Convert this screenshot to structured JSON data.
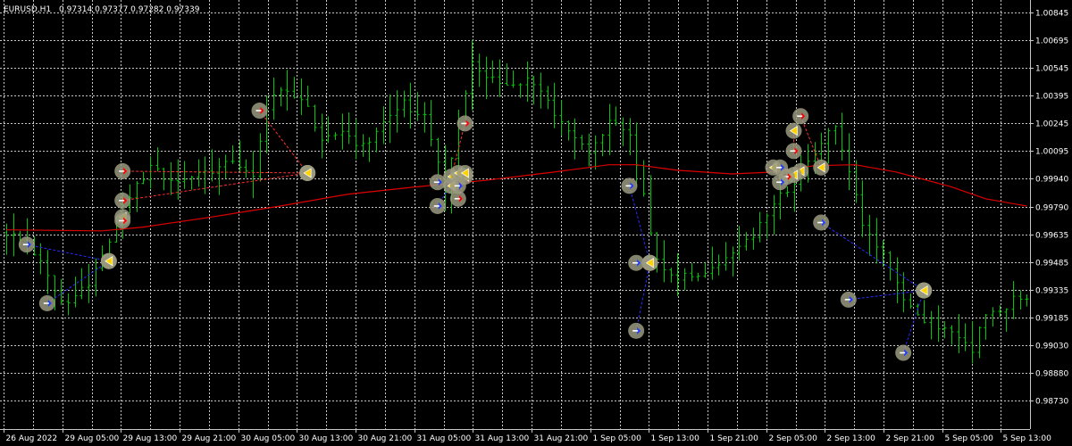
{
  "header": {
    "symbol": "EURUSD,H1",
    "ohlc": "0.97314 0.97377 0.97282 0.97339"
  },
  "colors": {
    "background": "#000000",
    "grid": "#c8c8c8",
    "bar": "#00c800",
    "moving_average": "#e00000",
    "buy_link": "#ff3030",
    "sell_link": "#2a2aff",
    "marker_ring": "#9a9a80",
    "buy_arrow": "#ff0000",
    "sell_arrow": "#1e3cff",
    "close_arrow": "#ffd200",
    "axis_text": "#ffffff"
  },
  "chart_data": {
    "type": "candlestick",
    "x_tick_labels": [
      "26 Aug 2022",
      "29 Aug 05:00",
      "29 Aug 13:00",
      "29 Aug 21:00",
      "30 Aug 05:00",
      "30 Aug 13:00",
      "30 Aug 21:00",
      "31 Aug 05:00",
      "31 Aug 13:00",
      "31 Aug 21:00",
      "1 Sep 05:00",
      "1 Sep 13:00",
      "1 Sep 21:00",
      "2 Sep 05:00",
      "2 Sep 13:00",
      "2 Sep 21:00",
      "5 Sep 05:00",
      "5 Sep 13:00"
    ],
    "y_tick_labels": [
      "1.00845",
      "1.00695",
      "1.00545",
      "1.00395",
      "1.00245",
      "1.00095",
      "0.99940",
      "0.99790",
      "0.99635",
      "0.99485",
      "0.99335",
      "0.99185",
      "0.99030",
      "0.98880",
      "0.98730"
    ],
    "ylim": [
      0.9873,
      1.00845
    ],
    "price_anchors": [
      [
        0,
        0.99645
      ],
      [
        3,
        0.996
      ],
      [
        5,
        0.9948
      ],
      [
        7,
        0.99315
      ],
      [
        9,
        0.99265
      ],
      [
        12,
        0.9938
      ],
      [
        14,
        0.99505
      ],
      [
        16,
        0.99715
      ],
      [
        18,
        0.99835
      ],
      [
        21,
        1.00015
      ],
      [
        24,
        0.99925
      ],
      [
        27,
        0.99945
      ],
      [
        30,
        0.99985
      ],
      [
        33,
        1.0002
      ],
      [
        36,
        0.9994
      ],
      [
        38,
        1.00335
      ],
      [
        40,
        1.0043
      ],
      [
        43,
        1.0039
      ],
      [
        46,
        1.0015
      ],
      [
        49,
        1.0018
      ],
      [
        52,
        1.0012
      ],
      [
        55,
        1.00235
      ],
      [
        58,
        1.0035
      ],
      [
        61,
        1.0028
      ],
      [
        64,
        0.9987
      ],
      [
        66,
        1.00245
      ],
      [
        68,
        1.00575
      ],
      [
        70,
        1.00485
      ],
      [
        73,
        1.00455
      ],
      [
        76,
        1.0048
      ],
      [
        79,
        1.0036
      ],
      [
        82,
        1.00195
      ],
      [
        85,
        1.00095
      ],
      [
        88,
        1.0025
      ],
      [
        91,
        1.0016
      ],
      [
        93,
        0.99835
      ],
      [
        95,
        0.9948
      ],
      [
        97,
        0.9942
      ],
      [
        100,
        0.99395
      ],
      [
        103,
        0.99455
      ],
      [
        106,
        0.9955
      ],
      [
        109,
        0.99625
      ],
      [
        112,
        0.99795
      ],
      [
        115,
        0.9993
      ],
      [
        117,
        1.0002
      ],
      [
        119,
        1.00145
      ],
      [
        121,
        1.00235
      ],
      [
        123,
        0.99985
      ],
      [
        125,
        0.9968
      ],
      [
        127,
        0.99555
      ],
      [
        129,
        0.99465
      ],
      [
        131,
        0.99265
      ],
      [
        133,
        0.99195
      ],
      [
        135,
        0.99155
      ],
      [
        137,
        0.99125
      ],
      [
        139,
        0.99065
      ],
      [
        141,
        0.99015
      ],
      [
        143,
        0.9919
      ],
      [
        145,
        0.992
      ],
      [
        147,
        0.9928
      ],
      [
        149,
        0.99295
      ]
    ],
    "moving_average": [
      [
        0,
        0.9966
      ],
      [
        14,
        0.99655
      ],
      [
        20,
        0.99675
      ],
      [
        30,
        0.9973
      ],
      [
        40,
        0.9979
      ],
      [
        50,
        0.99855
      ],
      [
        60,
        0.99895
      ],
      [
        70,
        0.9993
      ],
      [
        80,
        0.99975
      ],
      [
        88,
        1.00015
      ],
      [
        92,
        1.00015
      ],
      [
        98,
        0.99985
      ],
      [
        106,
        0.99965
      ],
      [
        112,
        0.99975
      ],
      [
        118,
        1.0001
      ],
      [
        124,
        1.00015
      ],
      [
        130,
        0.99975
      ],
      [
        138,
        0.99895
      ],
      [
        143,
        0.9983
      ],
      [
        149,
        0.9979
      ]
    ],
    "trades": [
      {
        "side": "sell",
        "open": [
          3,
          0.9958
        ],
        "close": [
          15,
          0.9949
        ]
      },
      {
        "side": "sell",
        "open": [
          6,
          0.9926
        ],
        "close": [
          15,
          0.9949
        ]
      },
      {
        "side": "buy",
        "open": [
          17,
          0.9998
        ],
        "close": [
          44,
          0.9997
        ]
      },
      {
        "side": "buy",
        "open": [
          17,
          0.9982
        ],
        "close": [
          44,
          0.9997
        ]
      },
      {
        "side": "buy",
        "open": [
          17,
          0.9971
        ],
        "close": [
          17,
          0.9973
        ]
      },
      {
        "side": "buy",
        "open": [
          37,
          1.0031
        ],
        "close": [
          44,
          0.9997
        ]
      },
      {
        "side": "buy",
        "open": [
          67,
          1.0024
        ],
        "close": [
          65,
          0.9995
        ]
      },
      {
        "side": "buy",
        "open": [
          66,
          0.9983
        ],
        "close": [
          67,
          0.9995
        ]
      },
      {
        "side": "sell",
        "open": [
          63,
          0.9992
        ],
        "close": [
          65,
          0.999
        ]
      },
      {
        "side": "sell",
        "open": [
          63,
          0.9979
        ],
        "close": [
          66,
          0.9997
        ]
      },
      {
        "side": "sell",
        "open": [
          66,
          0.999
        ],
        "close": [
          67,
          0.9997
        ]
      },
      {
        "side": "sell",
        "open": [
          91,
          0.999
        ],
        "close": [
          94,
          0.9948
        ]
      },
      {
        "side": "sell",
        "open": [
          92,
          0.9948
        ],
        "close": [
          94,
          0.9948
        ]
      },
      {
        "side": "sell",
        "open": [
          92,
          0.9911
        ],
        "close": [
          94,
          0.9948
        ]
      },
      {
        "side": "buy",
        "open": [
          116,
          1.0028
        ],
        "close": [
          119,
          1.0
        ]
      },
      {
        "side": "buy",
        "open": [
          115,
          1.0009
        ],
        "close": [
          115,
          1.002
        ]
      },
      {
        "side": "buy",
        "open": [
          114,
          0.9995
        ],
        "close": [
          112,
          1.0
        ]
      },
      {
        "side": "sell",
        "open": [
          113,
          1.0
        ],
        "close": [
          116,
          0.9998
        ]
      },
      {
        "side": "sell",
        "open": [
          113,
          0.9992
        ],
        "close": [
          115,
          0.9996
        ]
      },
      {
        "side": "sell",
        "open": [
          119,
          0.997
        ],
        "close": [
          134,
          0.9933
        ]
      },
      {
        "side": "sell",
        "open": [
          123,
          0.9928
        ],
        "close": [
          134,
          0.9933
        ]
      },
      {
        "side": "sell",
        "open": [
          131,
          0.9899
        ],
        "close": [
          134,
          0.9933
        ]
      }
    ]
  }
}
